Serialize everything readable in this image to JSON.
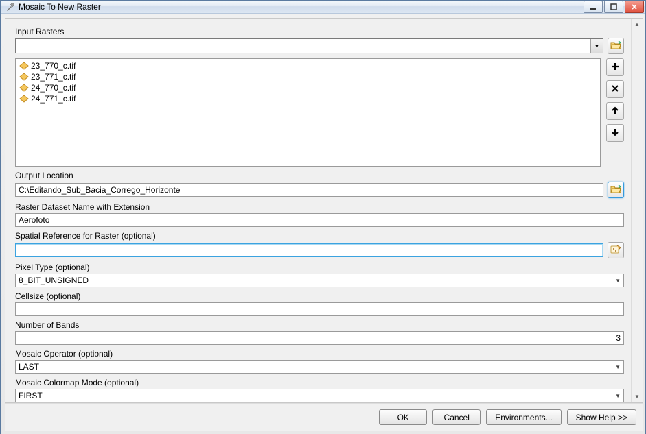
{
  "window": {
    "title": "Mosaic To New Raster",
    "icon": "hammer-icon"
  },
  "input_rasters": {
    "label": "Input Rasters",
    "combo_value": "",
    "items": [
      "23_770_c.tif",
      "23_771_c.tif",
      "24_770_c.tif",
      "24_771_c.tif"
    ]
  },
  "output_location": {
    "label": "Output Location",
    "value": "C:\\Editando_Sub_Bacia_Corrego_Horizonte"
  },
  "dataset_name": {
    "label": "Raster Dataset Name with Extension",
    "value": "Aerofoto"
  },
  "spatial_ref": {
    "label": "Spatial Reference for Raster (optional)",
    "value": ""
  },
  "pixel_type": {
    "label": "Pixel Type (optional)",
    "value": "8_BIT_UNSIGNED"
  },
  "cellsize": {
    "label": "Cellsize (optional)",
    "value": ""
  },
  "bands": {
    "label": "Number of Bands",
    "value": "3"
  },
  "mosaic_op": {
    "label": "Mosaic Operator (optional)",
    "value": "LAST"
  },
  "colormap_mode": {
    "label": "Mosaic Colormap Mode (optional)",
    "value": "FIRST"
  },
  "buttons": {
    "ok": "OK",
    "cancel": "Cancel",
    "env": "Environments...",
    "help": "Show Help >>"
  },
  "icons": {
    "browse": "📂",
    "plus": "＋",
    "remove": "✕",
    "up": "↑",
    "down": "↓",
    "props": "✎"
  }
}
